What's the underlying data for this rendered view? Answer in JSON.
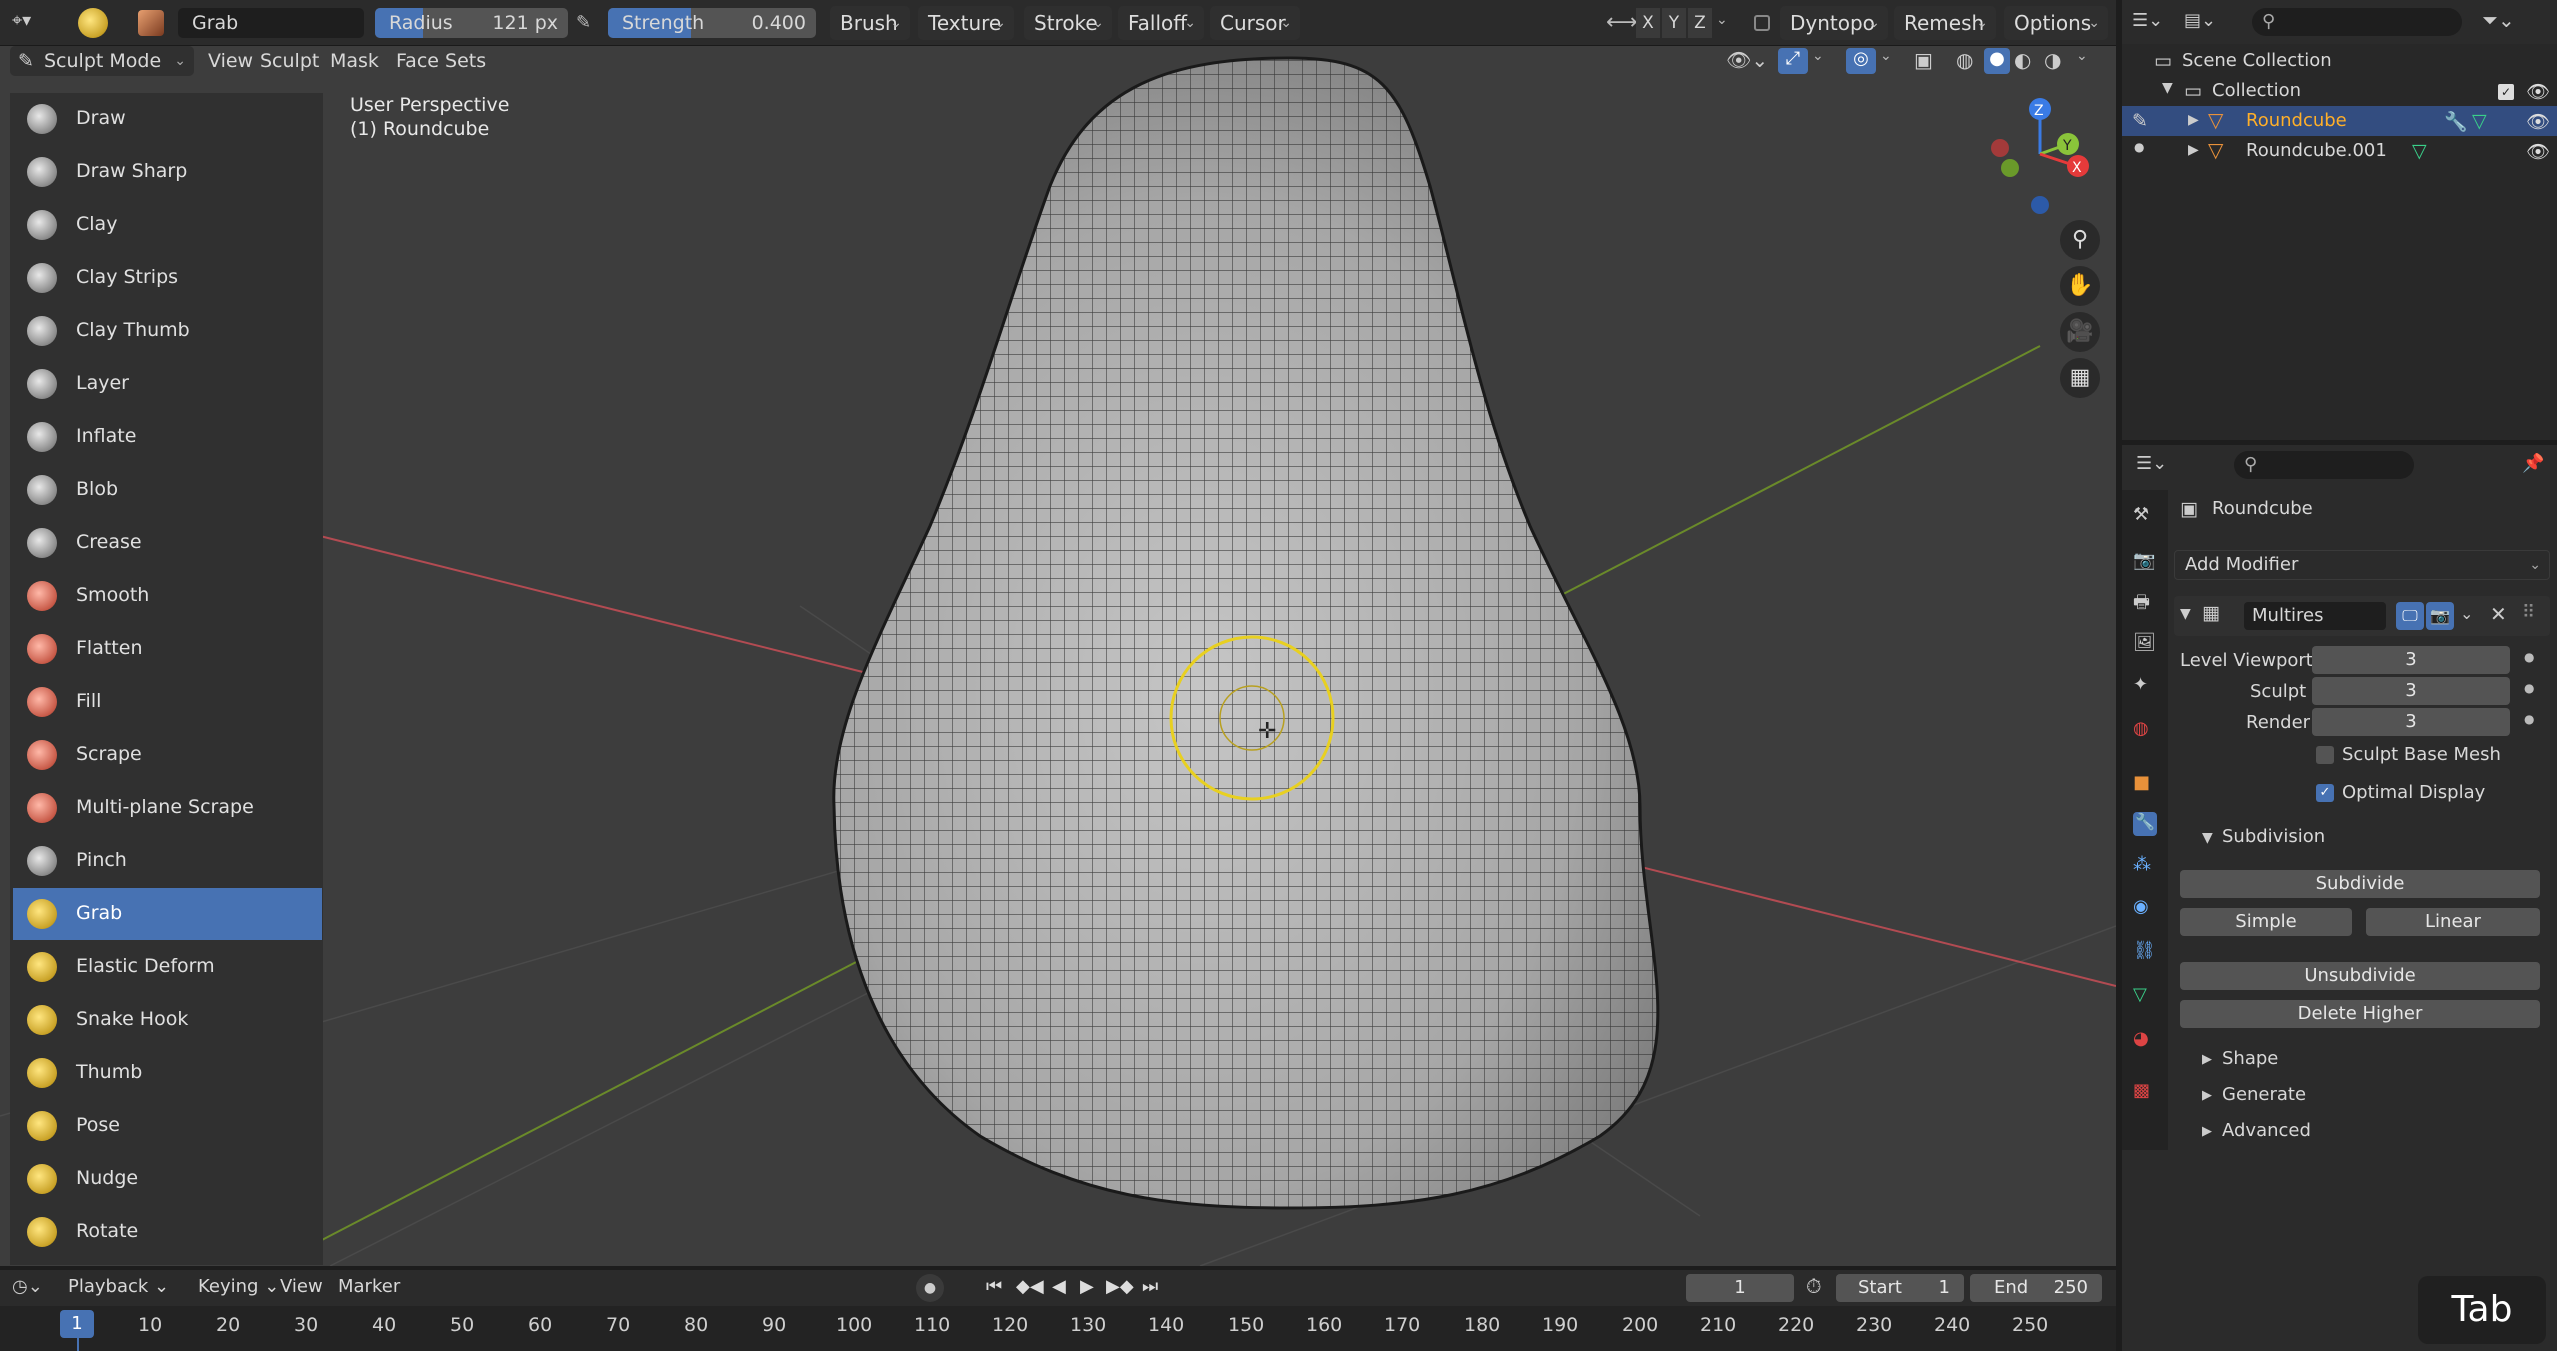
{
  "topbar": {
    "brush_name": "Grab",
    "radius_label": "Radius",
    "radius_value": "121 px",
    "strength_label": "Strength",
    "strength_value": "0.400",
    "menus": [
      "Brush",
      "Texture",
      "Stroke",
      "Falloff",
      "Cursor"
    ],
    "axis_x": "X",
    "axis_y": "Y",
    "axis_z": "Z",
    "dyntopo": "Dyntopo",
    "remesh": "Remesh",
    "options": "Options"
  },
  "header": {
    "mode": "Sculpt Mode",
    "menus": [
      "View",
      "Sculpt",
      "Mask",
      "Face Sets"
    ]
  },
  "viewport": {
    "perspective": "User Perspective",
    "object": "(1) Roundcube",
    "gizmo_axes": {
      "z": "Z",
      "y": "Y",
      "x": "X"
    },
    "colors": {
      "x": "#e53a3a",
      "y": "#8ac43a",
      "z": "#3a7be5",
      "brush_circle": "#e8d020"
    }
  },
  "tools": [
    {
      "label": "Draw"
    },
    {
      "label": "Draw Sharp"
    },
    {
      "label": "Clay"
    },
    {
      "label": "Clay Strips"
    },
    {
      "label": "Clay Thumb"
    },
    {
      "label": "Layer"
    },
    {
      "label": "Inflate"
    },
    {
      "label": "Blob"
    },
    {
      "label": "Crease"
    },
    {
      "label": "Smooth"
    },
    {
      "label": "Flatten"
    },
    {
      "label": "Fill"
    },
    {
      "label": "Scrape"
    },
    {
      "label": "Multi-plane Scrape"
    },
    {
      "label": "Pinch"
    },
    {
      "label": "Grab"
    },
    {
      "label": "Elastic Deform"
    },
    {
      "label": "Snake Hook"
    },
    {
      "label": "Thumb"
    },
    {
      "label": "Pose"
    },
    {
      "label": "Nudge"
    },
    {
      "label": "Rotate"
    }
  ],
  "active_tool": "Grab",
  "outliner": {
    "scene_collection": "Scene Collection",
    "collection": "Collection",
    "objects": [
      {
        "name": "Roundcube",
        "selected": true
      },
      {
        "name": "Roundcube.001",
        "selected": false
      }
    ]
  },
  "properties": {
    "object_name": "Roundcube",
    "add_modifier": "Add Modifier",
    "modifier_name": "Multires",
    "level_viewport_label": "Level Viewport",
    "level_viewport": "3",
    "sculpt_label": "Sculpt",
    "sculpt": "3",
    "render_label": "Render",
    "render": "3",
    "sculpt_base_mesh": "Sculpt Base Mesh",
    "optimal_display": "Optimal Display",
    "subdivision_label": "Subdivision",
    "subdivide": "Subdivide",
    "simple": "Simple",
    "linear": "Linear",
    "unsubdivide": "Unsubdivide",
    "delete_higher": "Delete Higher",
    "shape": "Shape",
    "generate": "Generate",
    "advanced": "Advanced"
  },
  "timeline": {
    "menus": [
      "Playback",
      "Keying",
      "View",
      "Marker"
    ],
    "current_frame": "1",
    "start_label": "Start",
    "start": "1",
    "end_label": "End",
    "end": "250",
    "ruler": [
      "1",
      "10",
      "20",
      "30",
      "40",
      "50",
      "60",
      "70",
      "80",
      "90",
      "100",
      "110",
      "120",
      "130",
      "140",
      "150",
      "160",
      "170",
      "180",
      "190",
      "200",
      "210",
      "220",
      "230",
      "240",
      "250"
    ]
  },
  "key_hint": "Tab"
}
